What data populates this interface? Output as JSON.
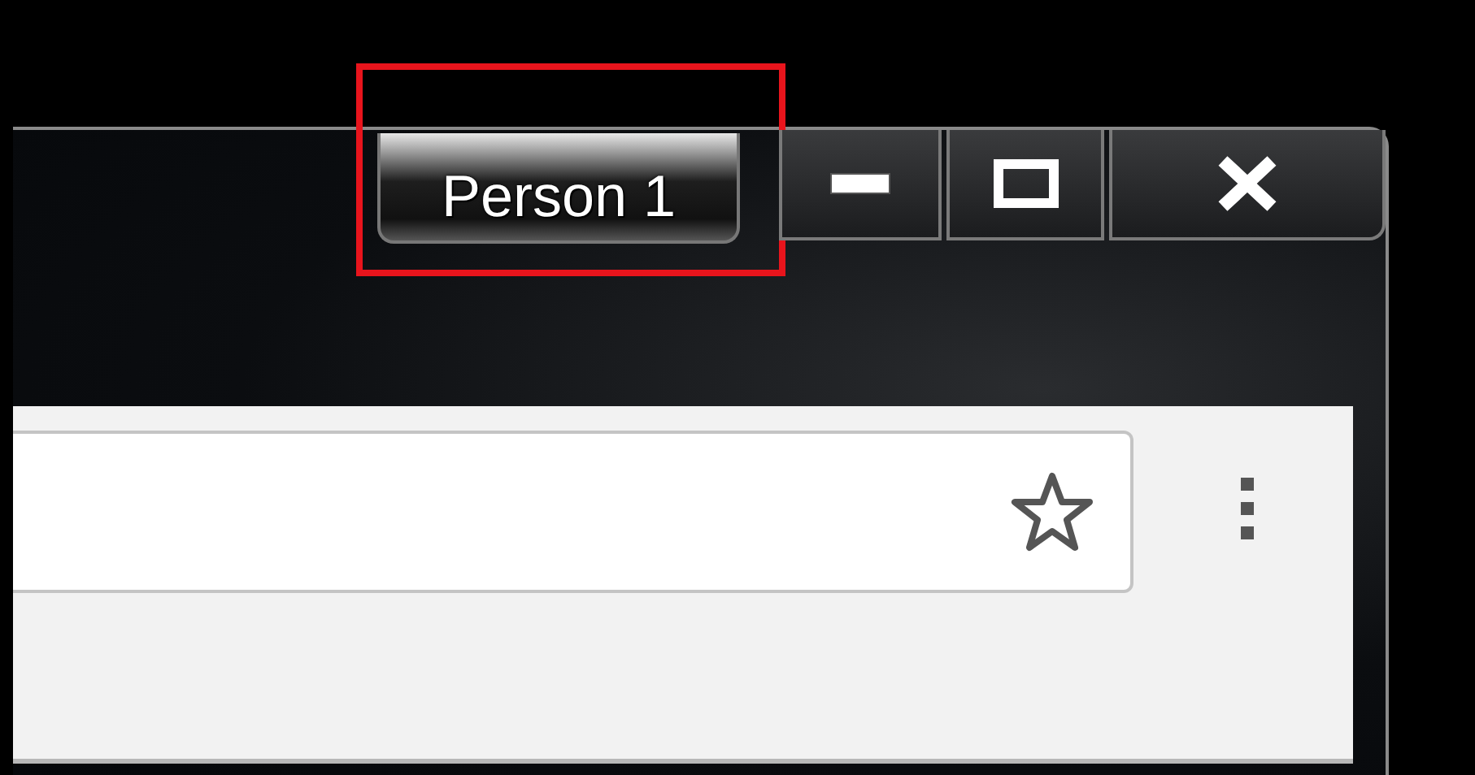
{
  "titlebar": {
    "profile_button": {
      "label": "Person 1",
      "highlighted": true
    },
    "window_controls": [
      {
        "kind": "minimize"
      },
      {
        "kind": "maximize"
      },
      {
        "kind": "close"
      }
    ]
  }
}
